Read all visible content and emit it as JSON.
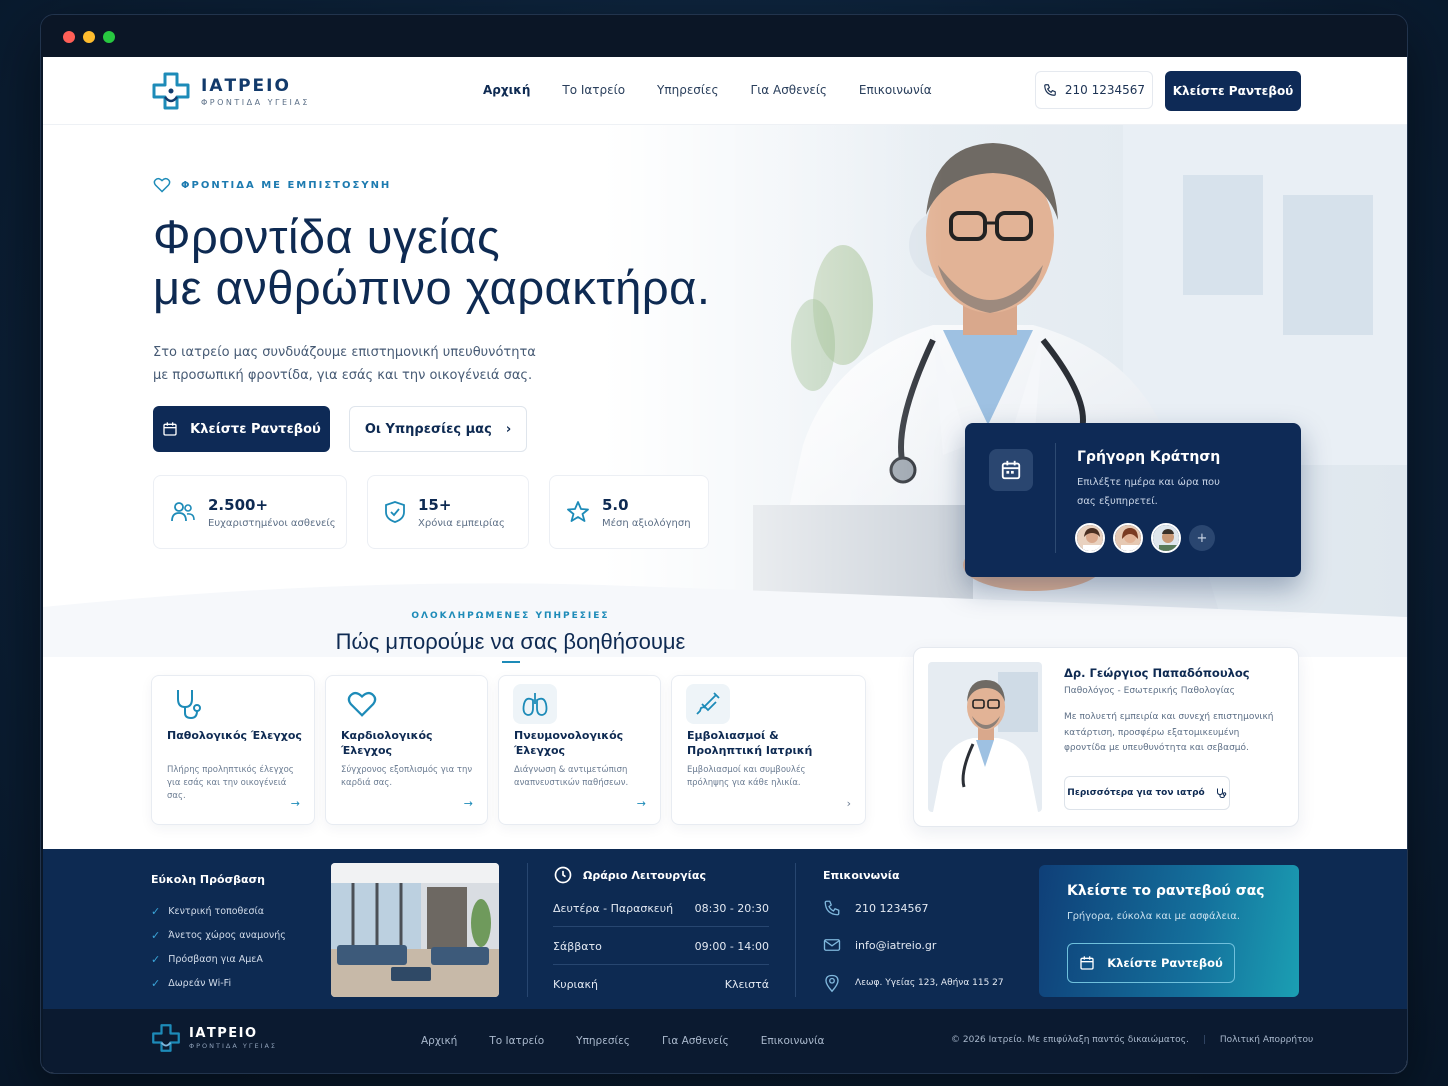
{
  "brand": {
    "name": "ΙΑΤΡΕΙΟ",
    "tagline": "ΦΡΟΝΤΙΔΑ ΥΓΕΙΑΣ",
    "accent": "#1d8bb8",
    "primary": "#0e2a56"
  },
  "nav": {
    "items": [
      "Αρχική",
      "Το Ιατρείο",
      "Υπηρεσίες",
      "Για Ασθενείς",
      "Επικοινωνία"
    ],
    "active": "Αρχική"
  },
  "header": {
    "phone": "210 1234567",
    "cta": "Κλείστε Ραντεβού"
  },
  "hero": {
    "eyebrow": "ΦΡΟΝΤΙΔΑ ΜΕ ΕΜΠΙΣΤΟΣΥΝΗ",
    "title_line1": "Φροντίδα υγείας",
    "title_line2": "με ανθρώπινο χαρακτήρα.",
    "lead": "Στο ιατρείο μας συνδυάζουμε επιστημονική υπευθυνότητα με προσωπική φροντίδα, για εσάς και την οικογένειά σας.",
    "primary_btn": "Κλείστε Ραντεβού",
    "secondary_btn": "Οι Υπηρεσίες μας",
    "stats": [
      {
        "value": "2.500+",
        "label": "Ευχαριστημένοι ασθενείς",
        "icon": "users-icon"
      },
      {
        "value": "15+",
        "label": "Χρόνια εμπειρίας",
        "icon": "shield-icon"
      },
      {
        "value": "5.0",
        "label": "Μέση αξιολόγηση",
        "icon": "star-icon"
      }
    ]
  },
  "booking": {
    "title": "Γρήγορη Κράτηση",
    "subtitle": "Επιλέξτε ημέρα και ώρα που σας εξυπηρετεί.",
    "more": "+"
  },
  "services": {
    "eyebrow": "ΟΛΟΚΛΗΡΩΜΕΝΕΣ ΥΠΗΡΕΣΙΕΣ",
    "title": "Πώς μπορούμε να σας βοηθήσουμε",
    "cards": [
      {
        "title": "Παθολογικός Έλεγχος",
        "text": "Πλήρης προληπτικός έλεγχος για εσάς και την οικογένειά σας.",
        "icon": "stethoscope-icon"
      },
      {
        "title": "Καρδιολογικός Έλεγχος",
        "text": "Σύγχρονος εξοπλισμός για την καρδιά σας.",
        "icon": "heart-icon"
      },
      {
        "title": "Πνευμονολογικός Έλεγχος",
        "text": "Διάγνωση & αντιμετώπιση αναπνευστικών παθήσεων.",
        "icon": "lungs-icon"
      },
      {
        "title": "Εμβολιασμοί & Προληπτική Ιατρική",
        "text": "Εμβολιασμοί και συμβουλές πρόληψης για κάθε ηλικία.",
        "icon": "syringe-icon"
      }
    ]
  },
  "doctor": {
    "name": "Δρ. Γεώργιος Παπαδόπουλος",
    "role": "Παθολόγος - Εσωτερικής Παθολογίας",
    "bio": "Με πολυετή εμπειρία και συνεχή επιστημονική κατάρτιση, προσφέρω εξατομικευμένη φροντίδα με υπευθυνότητα και σεβασμό.",
    "button": "Περισσότερα για τον ιατρό"
  },
  "access": {
    "title": "Εύκολη Πρόσβαση",
    "items": [
      "Κεντρική τοποθεσία",
      "Άνετος χώρος αναμονής",
      "Πρόσβαση για ΑμεΑ",
      "Δωρεάν Wi-Fi"
    ]
  },
  "hours": {
    "title": "Ωράριο Λειτουργίας",
    "rows": [
      {
        "day": "Δευτέρα - Παρασκευή",
        "time": "08:30 - 20:30"
      },
      {
        "day": "Σάββατο",
        "time": "09:00 - 14:00"
      },
      {
        "day": "Κυριακή",
        "time": "Κλειστά"
      }
    ]
  },
  "contact": {
    "title": "Επικοινωνία",
    "phone": "210 1234567",
    "email": "info@iatreio.gr",
    "address": "Λεωφ. Υγείας 123, Αθήνα 115 27"
  },
  "cta_box": {
    "title": "Κλείστε το ραντεβού σας",
    "subtitle": "Γρήγορα, εύκολα και με ασφάλεια.",
    "button": "Κλείστε Ραντεβού"
  },
  "footer": {
    "nav": [
      "Αρχική",
      "Το Ιατρείο",
      "Υπηρεσίες",
      "Για Ασθενείς",
      "Επικοινωνία"
    ],
    "copyright": "© 2026 Ιατρείο. Με επιφύλαξη παντός δικαιώματος.",
    "privacy": "Πολιτική Απορρήτου"
  }
}
